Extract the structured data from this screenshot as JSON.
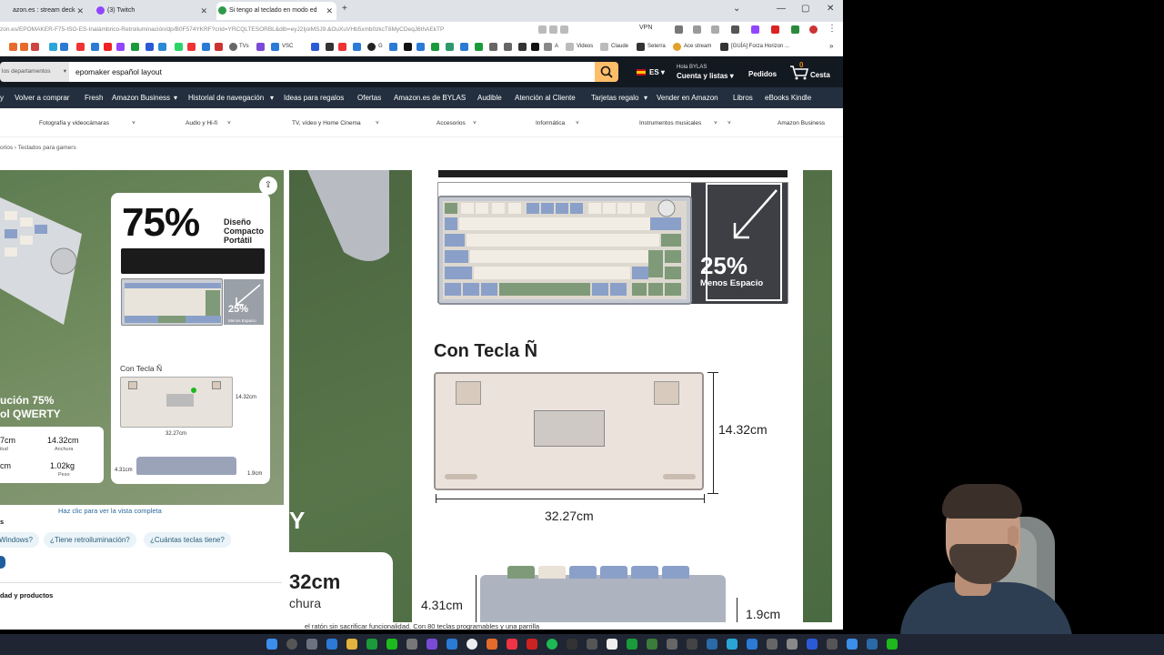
{
  "tabs": [
    {
      "title": "azon.es : stream deck"
    },
    {
      "title": "(3) Twitch"
    },
    {
      "title": "Si tengo al teclado en modo ed"
    }
  ],
  "address": {
    "url": "zon.es/EPOMAKER-F75-ISO-ES-Inalámbrico-Retroiluminación/dp/B0F574YKRF?crid=YRCQLTESORBL&dib=eyJ2IjoiMSJ9.&OuXuVHb5xmb0zkcT8MyCDeqJ6thAEkTP",
    "vpn": "VPN"
  },
  "bookmarks": [
    "TVs",
    "VSC",
    "G",
    "A",
    "Videos",
    "Claude",
    "Seterra",
    "Ace stream",
    "[GUÍA] Forza Horizon ..."
  ],
  "header": {
    "dept_label": "los departamentos",
    "search_value": "epomaker español layout",
    "lang": "ES",
    "greeting": "Hola BYLAS",
    "account": "Cuenta y listas",
    "orders": "Pedidos",
    "cart_count": "0",
    "cart": "Cesta"
  },
  "nav": [
    "Volver a comprar",
    "Fresh",
    "Amazon Business",
    "Historial de navegación",
    "Ideas para regalos",
    "Ofertas",
    "Amazon.es de BYLAS",
    "Audible",
    "Atención al Cliente",
    "Tarjetas regalo",
    "Vender en Amazon",
    "Libros",
    "eBooks Kindle"
  ],
  "subnav": [
    "Fotografía y videocámaras",
    "Audio y Hi-fi",
    "TV, vídeo y Home Cinema",
    "Accesorios",
    "Informática",
    "Instrumentos musicales",
    "Amazon Business"
  ],
  "breadcrumb": "orios › Teclados para gamers",
  "gallery": {
    "percent": "75%",
    "diseno": "Diseño Compacto Portátil",
    "mini_pct": "25%",
    "mini_menos": "Menos Espacio",
    "con_tecla": "Con Tecla Ñ",
    "dim_h": "14.32cm",
    "dim_w": "32.27cm",
    "dim_d": "4.31cm",
    "dim_t": "1.9cm",
    "overlay_line1": "ución 75%",
    "overlay_line2": "ol QWERTY",
    "specs": [
      {
        "value": "7cm",
        "label": "itud"
      },
      {
        "value": "14.32cm",
        "label": "Anchura"
      },
      {
        "value": "cm",
        "label": ""
      },
      {
        "value": "1.02kg",
        "label": "Peso"
      }
    ],
    "share_icon": "⇪",
    "fullview": "Haz clic para ver la vista completa"
  },
  "questions": {
    "label": "s",
    "chips": [
      "Windows?",
      "¿Tiene retroiluminación?",
      "¿Cuántas teclas tiene?"
    ]
  },
  "bottom_label": "dad y productos",
  "viewer": {
    "pct": "25%",
    "menos": "Menos Espacio",
    "con_tecla": "Con Tecla Ñ",
    "dim_h": "14.32cm",
    "dim_w": "32.27cm",
    "dim_d": "4.31cm",
    "dim_t": "1.9cm",
    "left_big": "Y",
    "left_dim": "32cm",
    "left_lbl": "chura"
  },
  "below_text": "el ratón sin sacrificar funcionalidad. Con 80 teclas programables y una parrilla"
}
